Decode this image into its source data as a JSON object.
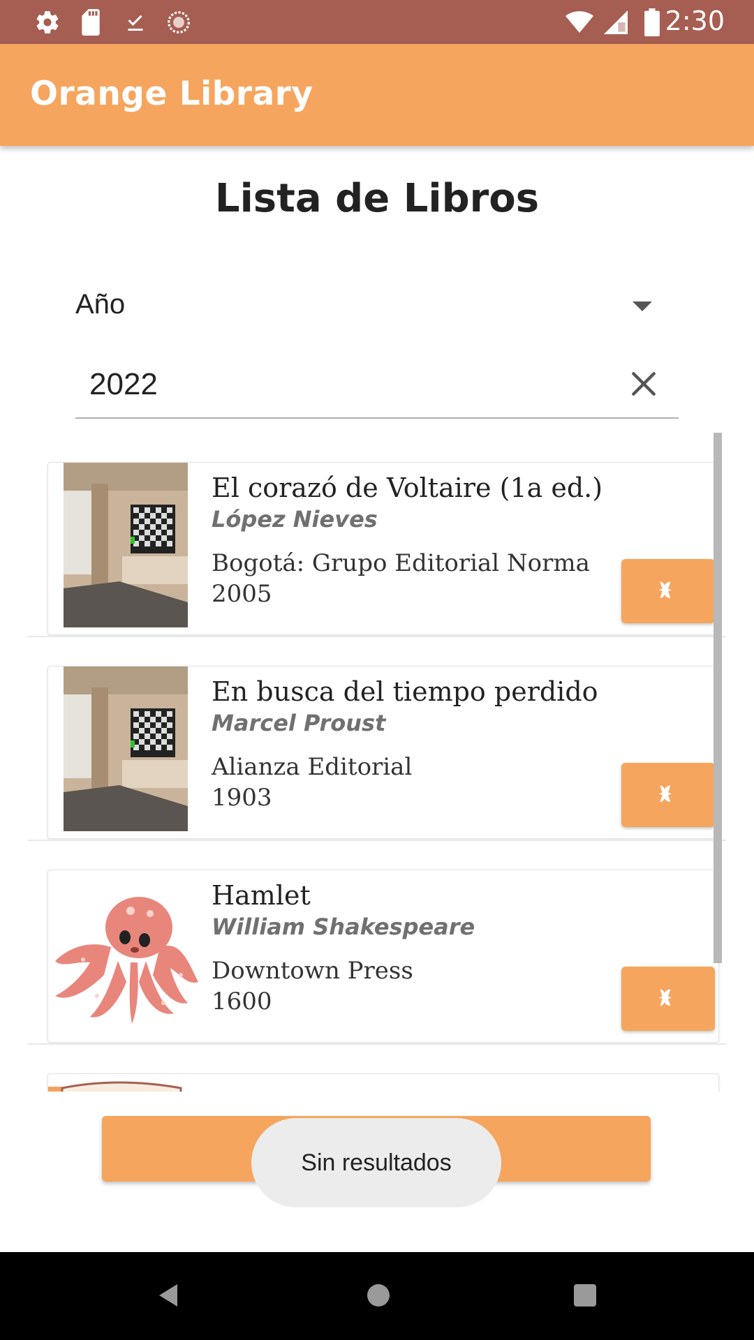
{
  "status_bar": {
    "time": "2:30",
    "left_icons": [
      "gear-icon",
      "sd-card-icon",
      "download-done-icon",
      "sync-icon"
    ],
    "right_icons": [
      "wifi-icon",
      "signal-icon",
      "battery-icon"
    ]
  },
  "app_bar": {
    "title": "Orange Library"
  },
  "page": {
    "title": "Lista de Libros"
  },
  "filter": {
    "selected": "Año",
    "options_icon": "dropdown-arrow-icon"
  },
  "search": {
    "value": "2022",
    "clear_icon": "close-icon"
  },
  "books": [
    {
      "title": "El corazó de Voltaire (1a ed.)",
      "author": "López Nieves",
      "publisher": "Bogotá: Grupo Editorial Norma",
      "year": "2005",
      "cover_icon": "room-image"
    },
    {
      "title": "En busca del tiempo perdido",
      "author": "Marcel Proust",
      "publisher": "Alianza Editorial",
      "year": "1903",
      "cover_icon": "room-image"
    },
    {
      "title": "Hamlet",
      "author": "William Shakespeare",
      "publisher": "Downtown Press",
      "year": "1600",
      "cover_icon": "octopus-image"
    }
  ],
  "card_action_icon": "puzzle-icon",
  "toast": {
    "text": "Sin resultados"
  },
  "nav_bar": {
    "icons": [
      "back-icon",
      "home-icon",
      "recents-icon"
    ]
  },
  "colors": {
    "status_bar": "#a65e52",
    "accent": "#f6a55e"
  }
}
